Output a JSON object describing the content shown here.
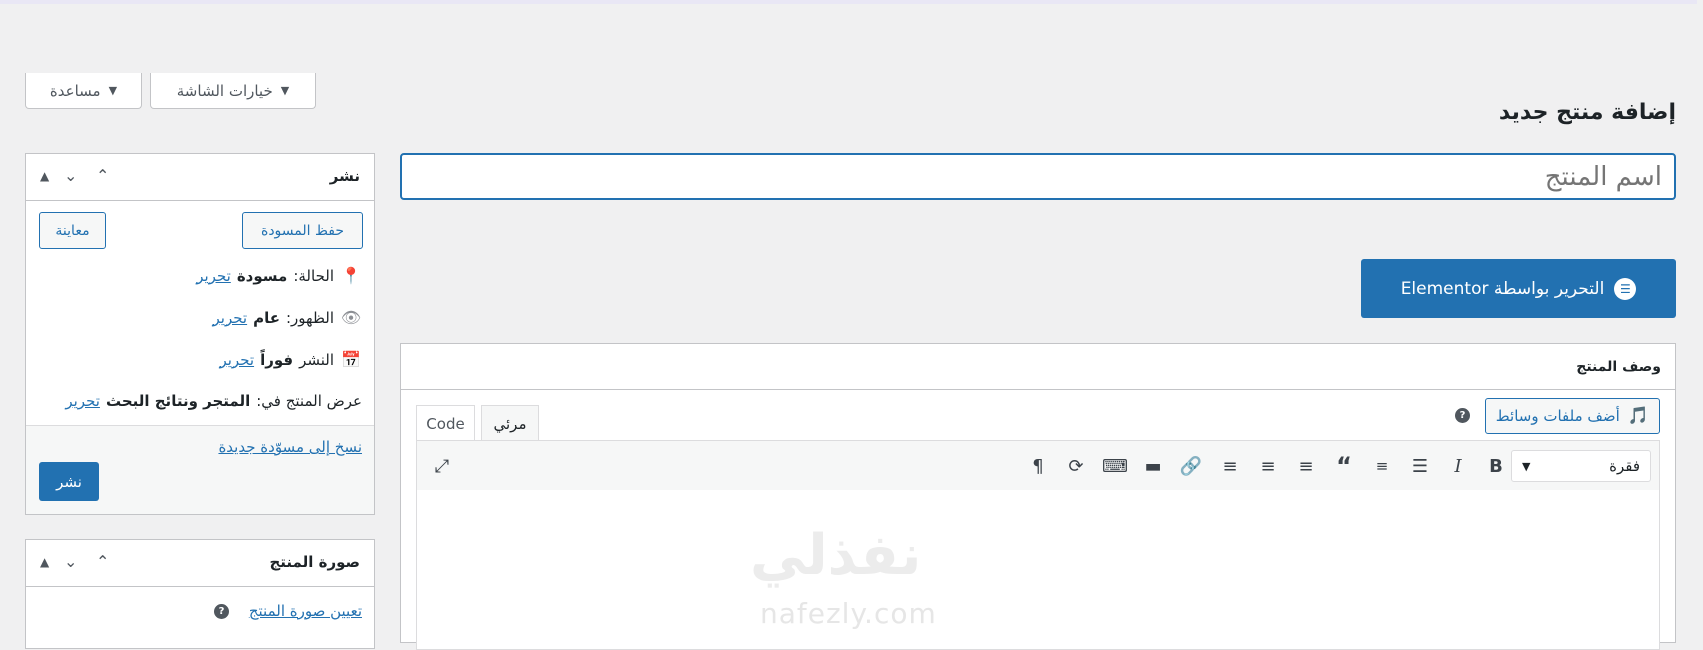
{
  "screen_tabs": {
    "options": "خيارات الشاشة",
    "help": "مساعدة"
  },
  "page_title": "إضافة منتج جديد",
  "title_input": {
    "placeholder": "اسم المنتج"
  },
  "elementor_button": "التحرير بواسطة Elementor",
  "description": {
    "heading": "وصف المنتج",
    "add_media": "أضف ملفات وسائط",
    "tabs": [
      "مرئي",
      "Code"
    ],
    "format": "فقرة",
    "watermark_ar": "نفذلي",
    "watermark_en": "nafezly.com"
  },
  "publish": {
    "title": "نشر",
    "save_draft": "حفظ المسودة",
    "preview": "معاينة",
    "status_label": "الحالة:",
    "status_value": "مسودة",
    "visibility_label": "الظهور:",
    "visibility_value": "عام",
    "publish_label": "النشر",
    "publish_value": "فوراً",
    "catalog_label": "عرض المنتج في:",
    "catalog_value": "المتجر ونتائج البحث",
    "edit": "تحرير",
    "copy_draft": "نسخ إلى مسوّدة جديدة",
    "publish_button": "نشر"
  },
  "product_image": {
    "title": "صورة المنتج",
    "set_image": "تعيين صورة المنتج"
  },
  "colors": {
    "accent": "#2271b1",
    "background": "#f0f0f1"
  }
}
